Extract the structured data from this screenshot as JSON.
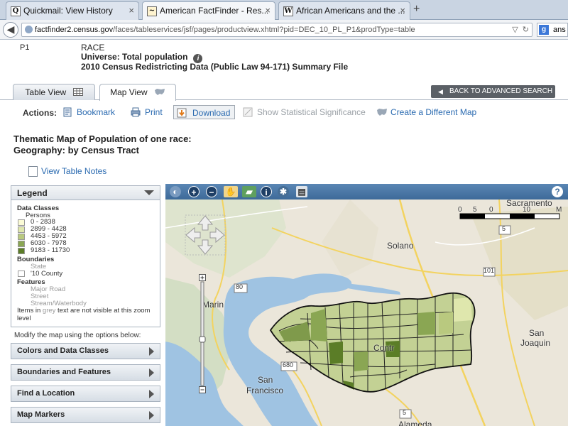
{
  "browser": {
    "tabs": [
      {
        "title": "Quickmail: View History",
        "favicon": "Q"
      },
      {
        "title": "American FactFinder - Res...",
        "favicon": "~"
      },
      {
        "title": "African Americans and the ...",
        "favicon": "W"
      }
    ],
    "new_tab": "+",
    "url_host": "factfinder2.census.gov",
    "url_path": "/faces/tableservices/jsf/pages/productview.xhtml?pid=DEC_10_PL_P1&prodType=table",
    "search_engine": "g",
    "search_text": "ans"
  },
  "table": {
    "id": "P1",
    "title": "RACE",
    "universe": "Universe: Total population",
    "file": "2010 Census Redistricting Data (Public Law 94-171) Summary File"
  },
  "views": {
    "table_view": "Table View",
    "map_view": "Map View",
    "back_advanced": "BACK TO ADVANCED SEARCH"
  },
  "actions": {
    "label": "Actions:",
    "bookmark": "Bookmark",
    "print": "Print",
    "download": "Download",
    "significance": "Show Statistical Significance",
    "different_map": "Create a Different Map"
  },
  "map_title": {
    "line1": "Thematic Map of Population of one race:",
    "line2": "Geography: by Census Tract"
  },
  "notes_link": "View Table Notes",
  "legend": {
    "header": "Legend",
    "data_classes": "Data Classes",
    "unit": "Persons",
    "classes": [
      {
        "label": "0 - 2838",
        "color": "#fbfbd6"
      },
      {
        "label": "2899 - 4428",
        "color": "#dfe7ad"
      },
      {
        "label": "4453 - 5972",
        "color": "#b9c97f"
      },
      {
        "label": "6030 - 7978",
        "color": "#8aa653"
      },
      {
        "label": "9183 - 11730",
        "color": "#5b7d27"
      }
    ],
    "boundaries": "Boundaries",
    "boundary_state": "State",
    "boundary_county": "'10 County",
    "features": "Features",
    "feature_road": "Major Road",
    "feature_street": "Street",
    "feature_water": "Stream/Waterbody",
    "note_pre": "Items in ",
    "note_grey": "grey",
    "note_post": " text are not visible at this zoom",
    "note_level": "level"
  },
  "modify_text": "Modify the map using the options below:",
  "accordions": [
    "Colors and Data Classes",
    "Boundaries and Features",
    "Find a Location",
    "Map Markers"
  ],
  "map": {
    "labels": {
      "sacramento": "Sacramento",
      "solano": "Solano",
      "marin": "Marin",
      "contra": "Contr",
      "san_joaquin_1": "San",
      "san_joaquin_2": "Joaquin",
      "sf_1": "San",
      "sf_2": "Francisco",
      "alameda": "Alameda"
    },
    "scale": {
      "t0": "0",
      "t1": "5",
      "t2": "0",
      "t3": "10",
      "t4": "M"
    },
    "shields": [
      "5",
      "80",
      "101",
      "680",
      "5"
    ],
    "help": "?"
  }
}
